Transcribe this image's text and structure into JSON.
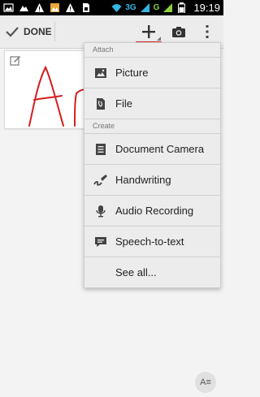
{
  "status_bar": {
    "network_label": "3G",
    "network_label_2": "G",
    "time": "19:19"
  },
  "action_bar": {
    "done_label": "DONE",
    "add_icon": "plus-icon",
    "camera_icon": "camera-icon",
    "overflow_icon": "overflow-menu-icon"
  },
  "note": {
    "handwriting_text": "Ar"
  },
  "menu": {
    "attach_header": "Attach",
    "create_header": "Create",
    "attach_items": [
      {
        "label": "Picture",
        "icon": "picture-icon"
      },
      {
        "label": "File",
        "icon": "file-icon"
      }
    ],
    "create_items": [
      {
        "label": "Document Camera",
        "icon": "document-icon"
      },
      {
        "label": "Handwriting",
        "icon": "handwriting-icon"
      },
      {
        "label": "Audio Recording",
        "icon": "microphone-icon"
      },
      {
        "label": "Speech-to-text",
        "icon": "speech-bubble-icon"
      },
      {
        "label": "See all...",
        "icon": ""
      }
    ]
  },
  "format_button": {
    "label": "A≡"
  },
  "colors": {
    "accent_red": "#d8262a",
    "handwriting_red": "#d51e1e",
    "status_blue": "#33b5e5",
    "status_green": "#8fcf3c"
  }
}
